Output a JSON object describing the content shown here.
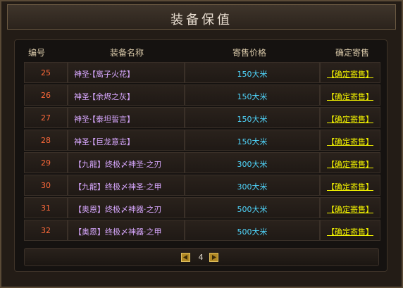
{
  "window": {
    "title": "装备保值"
  },
  "table": {
    "headers": [
      "编号",
      "装备名称",
      "寄售价格",
      "确定寄售"
    ],
    "rows": [
      {
        "id": "25",
        "name": "神圣·【离子火花】",
        "price": "150大米",
        "action": "【确定寄售】"
      },
      {
        "id": "26",
        "name": "神圣·【余烬之灰】",
        "price": "150大米",
        "action": "【确定寄售】"
      },
      {
        "id": "27",
        "name": "神圣·【泰坦誓言】",
        "price": "150大米",
        "action": "【确定寄售】"
      },
      {
        "id": "28",
        "name": "神圣·【巨龙意志】",
        "price": "150大米",
        "action": "【确定寄售】"
      },
      {
        "id": "29",
        "name": "【九龍】终极〆神圣·之刃",
        "price": "300大米",
        "action": "【确定寄售】"
      },
      {
        "id": "30",
        "name": "【九龍】终极〆神圣·之甲",
        "price": "300大米",
        "action": "【确定寄售】"
      },
      {
        "id": "31",
        "name": "【奥恩】终极〆神器·之刃",
        "price": "500大米",
        "action": "【确定寄售】"
      },
      {
        "id": "32",
        "name": "【奥恩】终极〆神器·之甲",
        "price": "500大米",
        "action": "【确定寄售】"
      }
    ]
  },
  "pager": {
    "page": "4"
  },
  "colors": {
    "id": "#ff6a3a",
    "name": "#d8a8ff",
    "price": "#50d8ff",
    "action": "#f2f200"
  }
}
